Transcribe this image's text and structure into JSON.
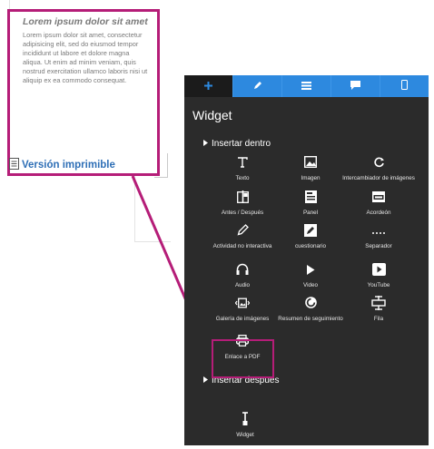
{
  "article": {
    "title": "Lorem ipsum dolor sit amet",
    "body": "Lorem ipsum dolor sit amet, consectetur adipisicing elit, sed do eiusmod tempor incididunt ut labore et dolore magna aliqua. Ut enim ad minim veniam, quis nostrud exercitation ullamco laboris nisi ut aliquip ex ea commodo consequat.",
    "print_link": "Versión imprimible"
  },
  "panel": {
    "tabs": [
      {
        "icon": "plus-icon",
        "active": true
      },
      {
        "icon": "pencil-icon",
        "active": false
      },
      {
        "icon": "list-icon",
        "active": false
      },
      {
        "icon": "chat-icon",
        "active": false
      },
      {
        "icon": "mobile-icon",
        "active": false
      }
    ],
    "title": "Widget",
    "section_inside": "Insertar dentro",
    "section_after": "Insertar despues",
    "widgets": [
      {
        "label": "Texto",
        "icon": "text-icon"
      },
      {
        "label": "Imagen",
        "icon": "image-icon"
      },
      {
        "label": "Intercambiador de imágenes",
        "icon": "swap-icon"
      },
      {
        "label": "Antes / Después",
        "icon": "before-after-icon"
      },
      {
        "label": "Panel",
        "icon": "panel-icon"
      },
      {
        "label": "Acordeón",
        "icon": "accordion-icon"
      },
      {
        "label": "Actividad no interactiva",
        "icon": "activity-pencil-icon"
      },
      {
        "label": "cuestionario",
        "icon": "quiz-icon"
      },
      {
        "label": "Separador",
        "icon": "separator-icon"
      },
      {
        "label": "Audio",
        "icon": "headphones-icon"
      },
      {
        "label": "Video",
        "icon": "play-icon"
      },
      {
        "label": "YouTube",
        "icon": "youtube-icon"
      },
      {
        "label": "Galería de imágenes",
        "icon": "gallery-icon"
      },
      {
        "label": "Resumen de seguimiento",
        "icon": "progress-summary-icon"
      },
      {
        "label": "Fila",
        "icon": "row-icon"
      },
      {
        "label": "Enlace a PDF",
        "icon": "printer-icon"
      }
    ],
    "after_widget": {
      "label": "Widget",
      "icon": "widget-icon"
    }
  },
  "colors": {
    "highlight": "#b51d78",
    "tab_blue": "#2d89df",
    "panel_bg": "#2b2b2b",
    "link_blue": "#2e6fb6"
  }
}
